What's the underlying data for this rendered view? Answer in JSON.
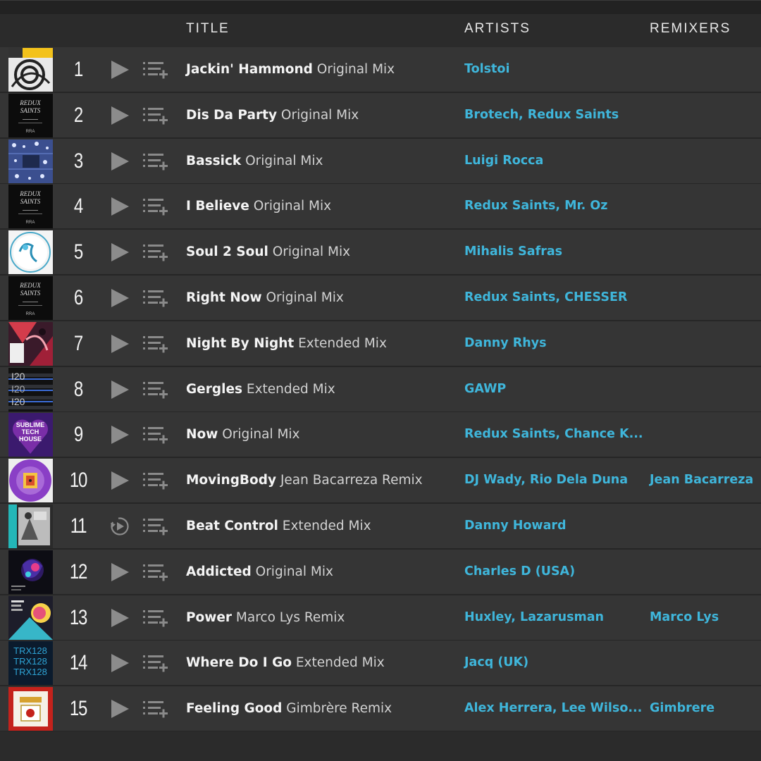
{
  "header": {
    "title": "TITLE",
    "artists": "ARTISTS",
    "remixers": "REMIXERS"
  },
  "colors": {
    "accent": "#3fb6db",
    "row_bg": "#353535",
    "header_bg": "#2b2b2b"
  },
  "tracks": [
    {
      "number": "1",
      "name": "Jackin' Hammond",
      "mix": "Original Mix",
      "artists": "Tolstoi",
      "remixers": "",
      "art": "yellow-swirl",
      "control": "play"
    },
    {
      "number": "2",
      "name": "Dis Da Party",
      "mix": "Original Mix",
      "artists": "Brotech, Redux Saints",
      "remixers": "",
      "art": "redux-black",
      "control": "play"
    },
    {
      "number": "3",
      "name": "Bassick",
      "mix": "Original Mix",
      "artists": "Luigi Rocca",
      "remixers": "",
      "art": "blue-pattern",
      "control": "play"
    },
    {
      "number": "4",
      "name": "I Believe",
      "mix": "Original Mix",
      "artists": "Redux Saints, Mr. Oz",
      "remixers": "",
      "art": "redux-black",
      "control": "play"
    },
    {
      "number": "5",
      "name": "Soul 2 Soul",
      "mix": "Original Mix",
      "artists": "Mihalis Safras",
      "remixers": "",
      "art": "white-vinyl",
      "control": "play"
    },
    {
      "number": "6",
      "name": "Right Now",
      "mix": "Original Mix",
      "artists": "Redux Saints, CHESSER",
      "remixers": "",
      "art": "redux-black",
      "control": "play"
    },
    {
      "number": "7",
      "name": "Night By Night",
      "mix": "Extended Mix",
      "artists": "Danny Rhys",
      "remixers": "",
      "art": "red-abstract",
      "control": "play"
    },
    {
      "number": "8",
      "name": "Gergles",
      "mix": "Extended Mix",
      "artists": "GAWP",
      "remixers": "",
      "art": "i20-stripes",
      "control": "play"
    },
    {
      "number": "9",
      "name": "Now",
      "mix": "Original Mix",
      "artists": "Redux Saints, Chance K...",
      "remixers": "",
      "art": "sublime-purple",
      "control": "play"
    },
    {
      "number": "10",
      "name": "MovingBody",
      "mix": "Jean Bacarreza Remix",
      "artists": "DJ Wady, Rio Dela Duna",
      "remixers": "Jean Bacarreza",
      "art": "purple-vinyl",
      "control": "play"
    },
    {
      "number": "11",
      "name": "Beat Control",
      "mix": "Extended Mix",
      "artists": "Danny Howard",
      "remixers": "",
      "art": "teal-bw",
      "control": "replay"
    },
    {
      "number": "12",
      "name": "Addicted",
      "mix": "Original Mix",
      "artists": "Charles D (USA)",
      "remixers": "",
      "art": "dark-blue",
      "control": "play"
    },
    {
      "number": "13",
      "name": "Power",
      "mix": "Marco Lys Remix",
      "artists": "Huxley, Lazarusman",
      "remixers": "Marco Lys",
      "art": "colorful",
      "control": "play"
    },
    {
      "number": "14",
      "name": "Where Do I Go",
      "mix": "Extended Mix",
      "artists": "Jacq (UK)",
      "remixers": "",
      "art": "trx128",
      "control": "play"
    },
    {
      "number": "15",
      "name": "Feeling Good",
      "mix": "Gimbrère Remix",
      "artists": "Alex Herrera, Lee Wilso...",
      "remixers": "Gimbrere",
      "art": "red-frame",
      "control": "play"
    }
  ]
}
